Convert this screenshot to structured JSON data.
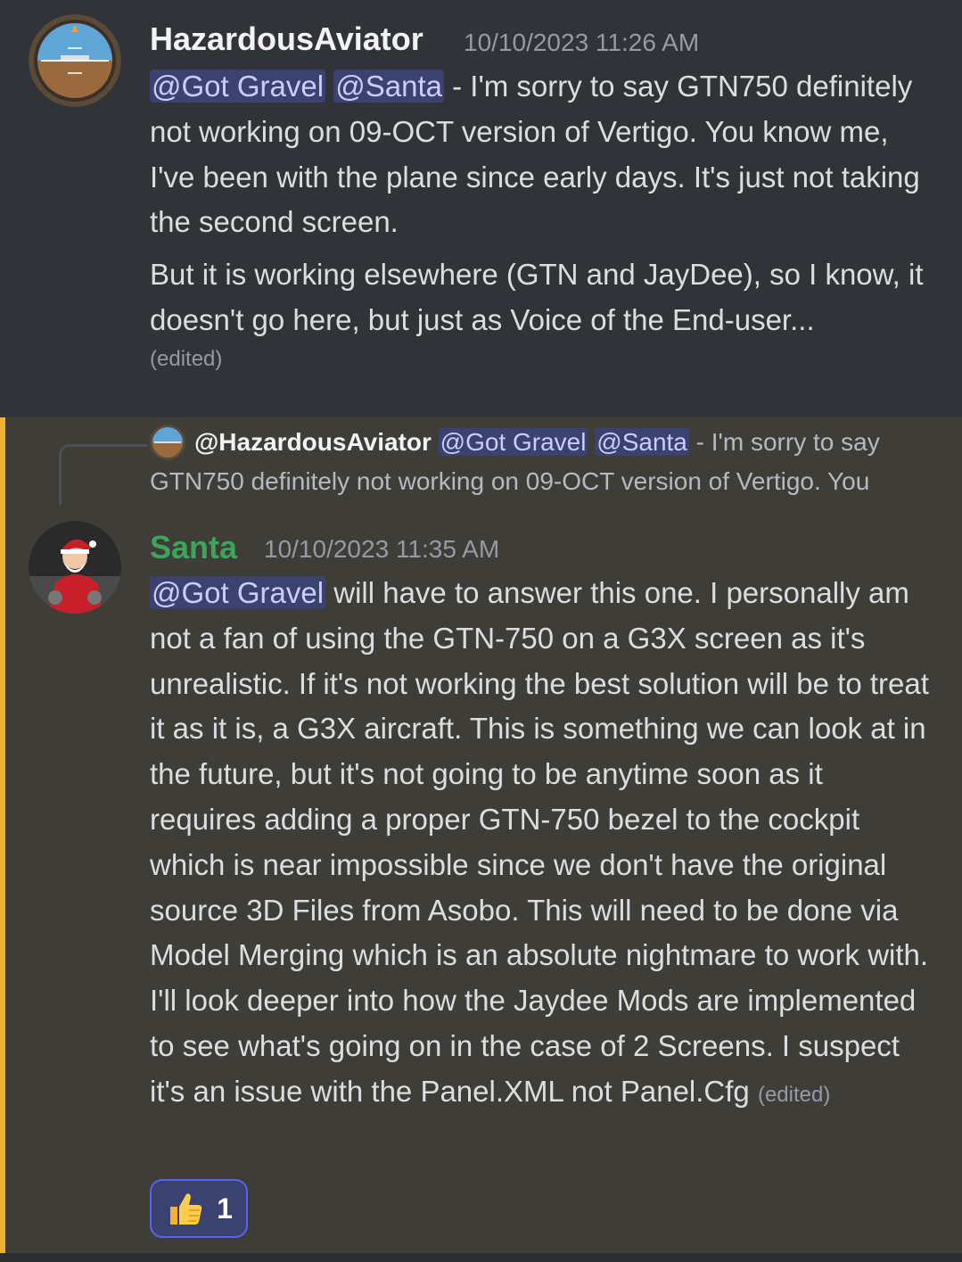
{
  "message1": {
    "username": "HazardousAviator",
    "username_color": "#f2f3f5",
    "timestamp": "10/10/2023 11:26 AM",
    "mention1": "@Got Gravel",
    "mention2": "@Santa",
    "text1": " - I'm sorry to say GTN750 definitely not working on 09-OCT version of Vertigo. You know me, I've been with the plane since early days. It's just not taking the second screen.",
    "text2": "But it is working elsewhere (GTN and JayDee), so I know, it doesn't go here, but just as Voice of the End-user...",
    "edited": "(edited)",
    "avatar_icon": "attitude-indicator-avatar"
  },
  "reply": {
    "username": "@HazardousAviator",
    "mention1": "@Got Gravel",
    "mention2": "@Santa",
    "snippet": " - I'm sorry to say GTN750 definitely not working on 09-OCT version of Vertigo. You"
  },
  "message2": {
    "username": "Santa",
    "username_color": "#3ba55c",
    "timestamp": "10/10/2023 11:35 AM",
    "mention1": "@Got Gravel",
    "text": " will have to answer this one. I personally am not a fan of using the GTN-750 on a G3X screen as it's unrealistic. If it's not working the best solution will be to treat it as it is, a G3X aircraft. This is something we can look at in the future, but it's not going to be anytime soon as it requires adding a proper GTN-750 bezel to the cockpit which is near impossible since we don't have the original source 3D Files from Asobo. This will need to be done via Model Merging which is an absolute nightmare to work with. I'll look deeper into how the Jaydee Mods are implemented to see what's going on in the case of 2 Screens. I suspect it's an issue with the Panel.XML not Panel.Cfg",
    "edited": "(edited)",
    "avatar_icon": "santa-avatar"
  },
  "reaction": {
    "emoji": "thumbs-up-icon",
    "count": "1"
  }
}
